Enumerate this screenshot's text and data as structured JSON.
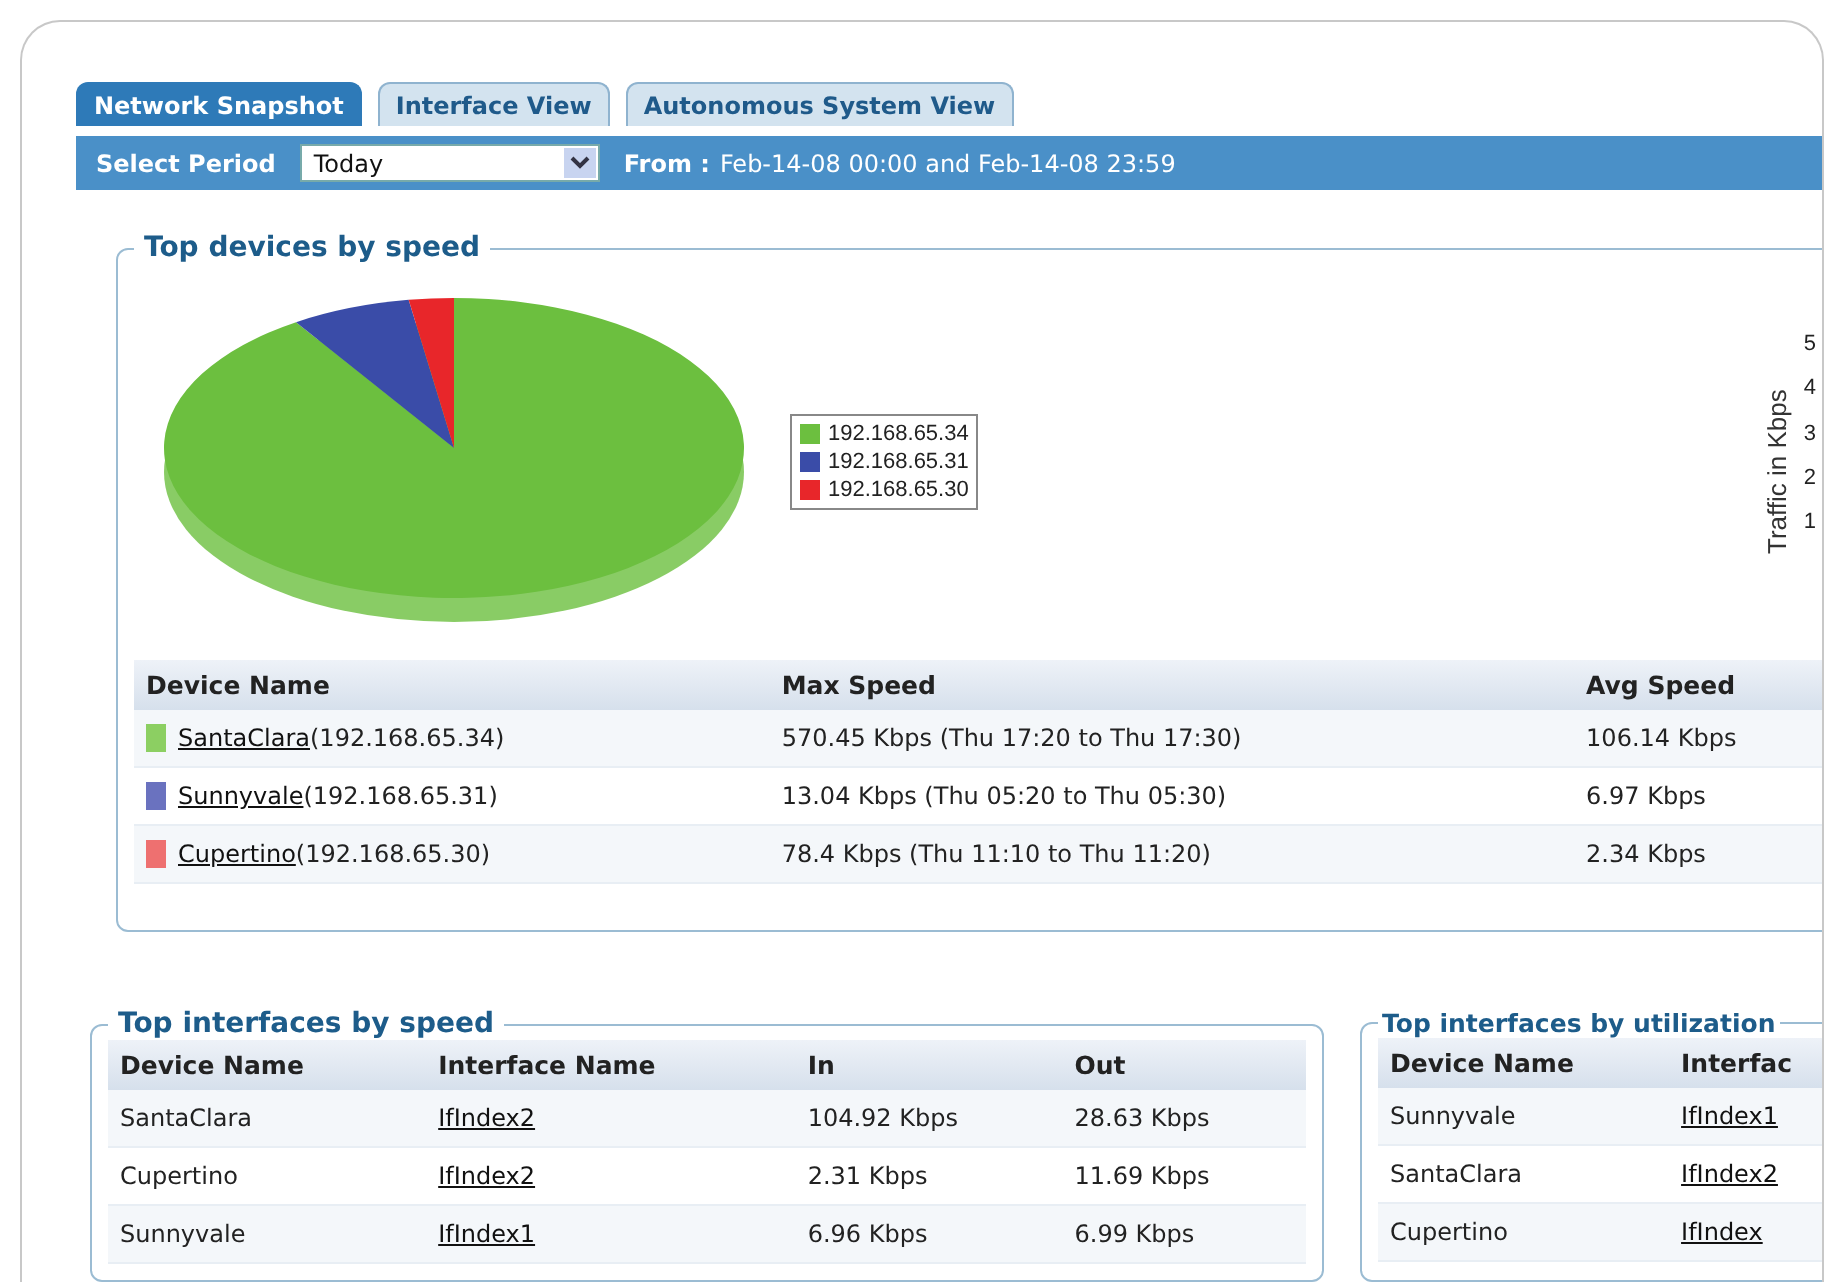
{
  "tabs": [
    {
      "label": "Network Snapshot",
      "selected": true
    },
    {
      "label": "Interface View",
      "selected": false
    },
    {
      "label": "Autonomous System View",
      "selected": false
    }
  ],
  "period_bar": {
    "label": "Select Period",
    "dropdown_value": "Today",
    "range_label": "From :",
    "range": "Feb-14-08 00:00 and Feb-14-08 23:59"
  },
  "top_devices": {
    "title": "Top devices by speed",
    "legend": [
      {
        "label": "192.168.65.34",
        "color": "#6cbf3f"
      },
      {
        "label": "192.168.65.31",
        "color": "#3a4ca8"
      },
      {
        "label": "192.168.65.30",
        "color": "#e8262a"
      }
    ],
    "side_chart": {
      "ylabel": "Traffic in Kbps",
      "ticks": [
        "5",
        "4",
        "3",
        "2",
        "1"
      ]
    },
    "columns": [
      "Device Name",
      "Max Speed",
      "Avg Speed"
    ],
    "rows": [
      {
        "color": "#8ccf62",
        "device": "SantaClara",
        "ip": "(192.168.65.34)",
        "max_speed": "570.45 Kbps (Thu 17:20 to Thu 17:30)",
        "avg_speed": "106.14 Kbps"
      },
      {
        "color": "#6a72bf",
        "device": "Sunnyvale",
        "ip": "(192.168.65.31)",
        "max_speed": "13.04 Kbps (Thu 05:20 to Thu 05:30)",
        "avg_speed": "6.97 Kbps"
      },
      {
        "color": "#ee7070",
        "device": "Cupertino",
        "ip": "(192.168.65.30)",
        "max_speed": "78.4 Kbps (Thu 11:10 to Thu 11:20)",
        "avg_speed": "2.34 Kbps"
      }
    ]
  },
  "top_interfaces_speed": {
    "title": "Top interfaces by speed",
    "columns": [
      "Device Name",
      "Interface Name",
      "In",
      "Out"
    ],
    "rows": [
      {
        "device": "SantaClara",
        "interface": "IfIndex2",
        "in": "104.92 Kbps",
        "out": "28.63 Kbps"
      },
      {
        "device": "Cupertino",
        "interface": "IfIndex2",
        "in": "2.31 Kbps",
        "out": "11.69 Kbps"
      },
      {
        "device": "Sunnyvale",
        "interface": "IfIndex1",
        "in": "6.96 Kbps",
        "out": "6.99 Kbps"
      }
    ]
  },
  "top_interfaces_utilization": {
    "title": "Top interfaces by utilization",
    "columns": [
      "Device Name",
      "Interfac"
    ],
    "rows": [
      {
        "device": "Sunnyvale",
        "interface": "IfIndex1"
      },
      {
        "device": "SantaClara",
        "interface": "IfIndex2"
      },
      {
        "device": "Cupertino",
        "interface": "IfIndex"
      }
    ]
  }
}
